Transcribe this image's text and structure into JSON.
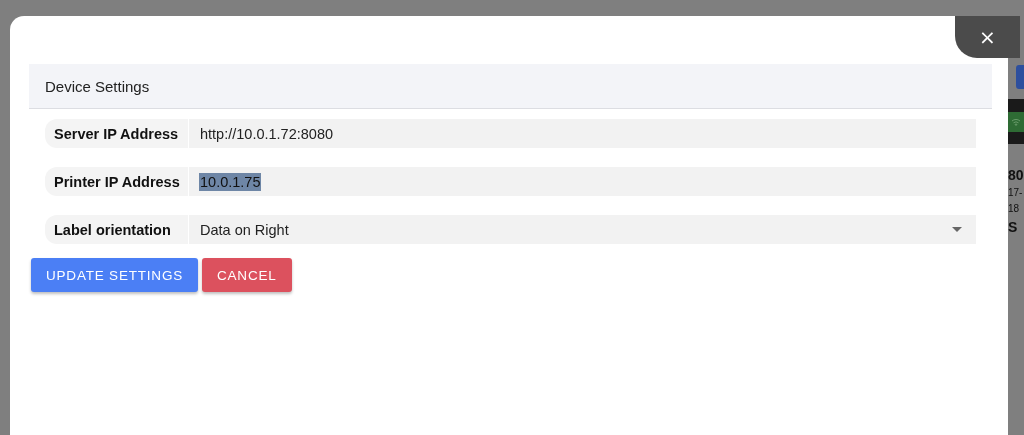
{
  "background_page": {
    "side_texts": [
      "80",
      "17-",
      "18",
      "S"
    ]
  },
  "dialog": {
    "title": "Device Settings",
    "close_label": "×",
    "fields": [
      {
        "label": "Server IP Address",
        "kind": "text",
        "value": "http://10.0.1.72:8080",
        "text_selected": false
      },
      {
        "label": "Printer IP Address",
        "kind": "text",
        "value": "10.0.1.75",
        "text_selected": true
      },
      {
        "label": "Label orientation",
        "kind": "select",
        "value": "Data on Right",
        "text_selected": false
      }
    ],
    "buttons": [
      {
        "label": "UPDATE SETTINGS",
        "kind": "primary"
      },
      {
        "label": "CANCEL",
        "kind": "danger"
      }
    ]
  }
}
